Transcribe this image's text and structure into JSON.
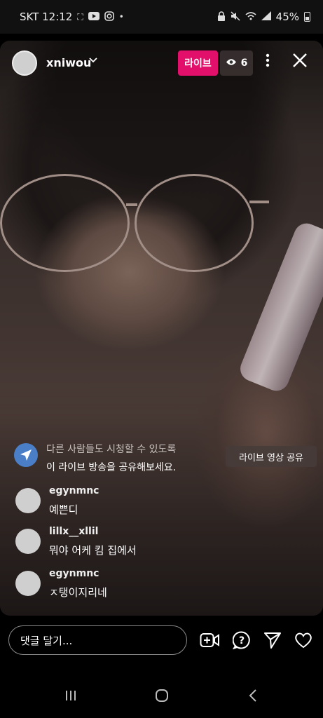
{
  "status_bar": {
    "carrier_time": "SKT 12:12",
    "battery": "45%",
    "icons": [
      "screen-record-icon",
      "youtube-icon",
      "instagram-icon",
      "dot-icon",
      "lock-icon",
      "mute-icon",
      "wifi-icon",
      "signal-icon",
      "battery-icon"
    ]
  },
  "header": {
    "username": "xniwou",
    "live_label": "라이브",
    "viewer_count": "6"
  },
  "share_prompt": {
    "line1": "다른 사람들도 시청할 수 있도록",
    "line2": "이 라이브 방송을 공유해보세요.",
    "button": "라이브 영상 공유"
  },
  "comments": [
    {
      "user": "egynmnc",
      "text": "예쁜디"
    },
    {
      "user": "lillx__xllil",
      "text": "뭐야 어케 킴 집에서"
    },
    {
      "user": "egynmnc",
      "text": "ㅈ탱이지리네"
    }
  ],
  "comment_box": {
    "placeholder": "댓글 달기..."
  },
  "colors": {
    "live_badge": "#e2106a",
    "share_icon_bg": "#4a7fc8"
  }
}
